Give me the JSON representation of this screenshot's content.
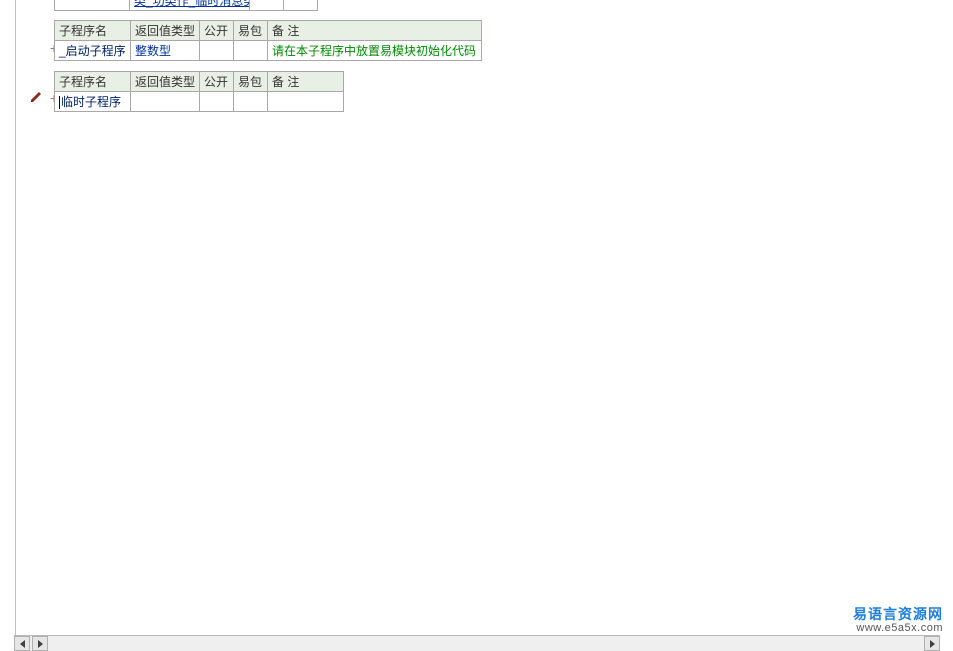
{
  "partialRow": {
    "c1_placeholder": "",
    "c2_link": "类_功类作_临时消息类",
    "c3": "",
    "c4": ""
  },
  "columns": {
    "name": "子程序名",
    "rettype": "返回值类型",
    "public": "公开",
    "easy": "易包",
    "remark": "备 注"
  },
  "proc1": {
    "name": "_启动子程序",
    "rettype": "整数型",
    "public": "",
    "easy": "",
    "remark": "请在本子程序中放置易模块初始化代码"
  },
  "proc2": {
    "name": "临时子程序",
    "rettype": "",
    "public": "",
    "easy": "",
    "remark": ""
  },
  "symbols": {
    "plus": "+"
  },
  "watermark": {
    "line1": "易语言资源网",
    "line2": "www.e5a5x.com"
  }
}
